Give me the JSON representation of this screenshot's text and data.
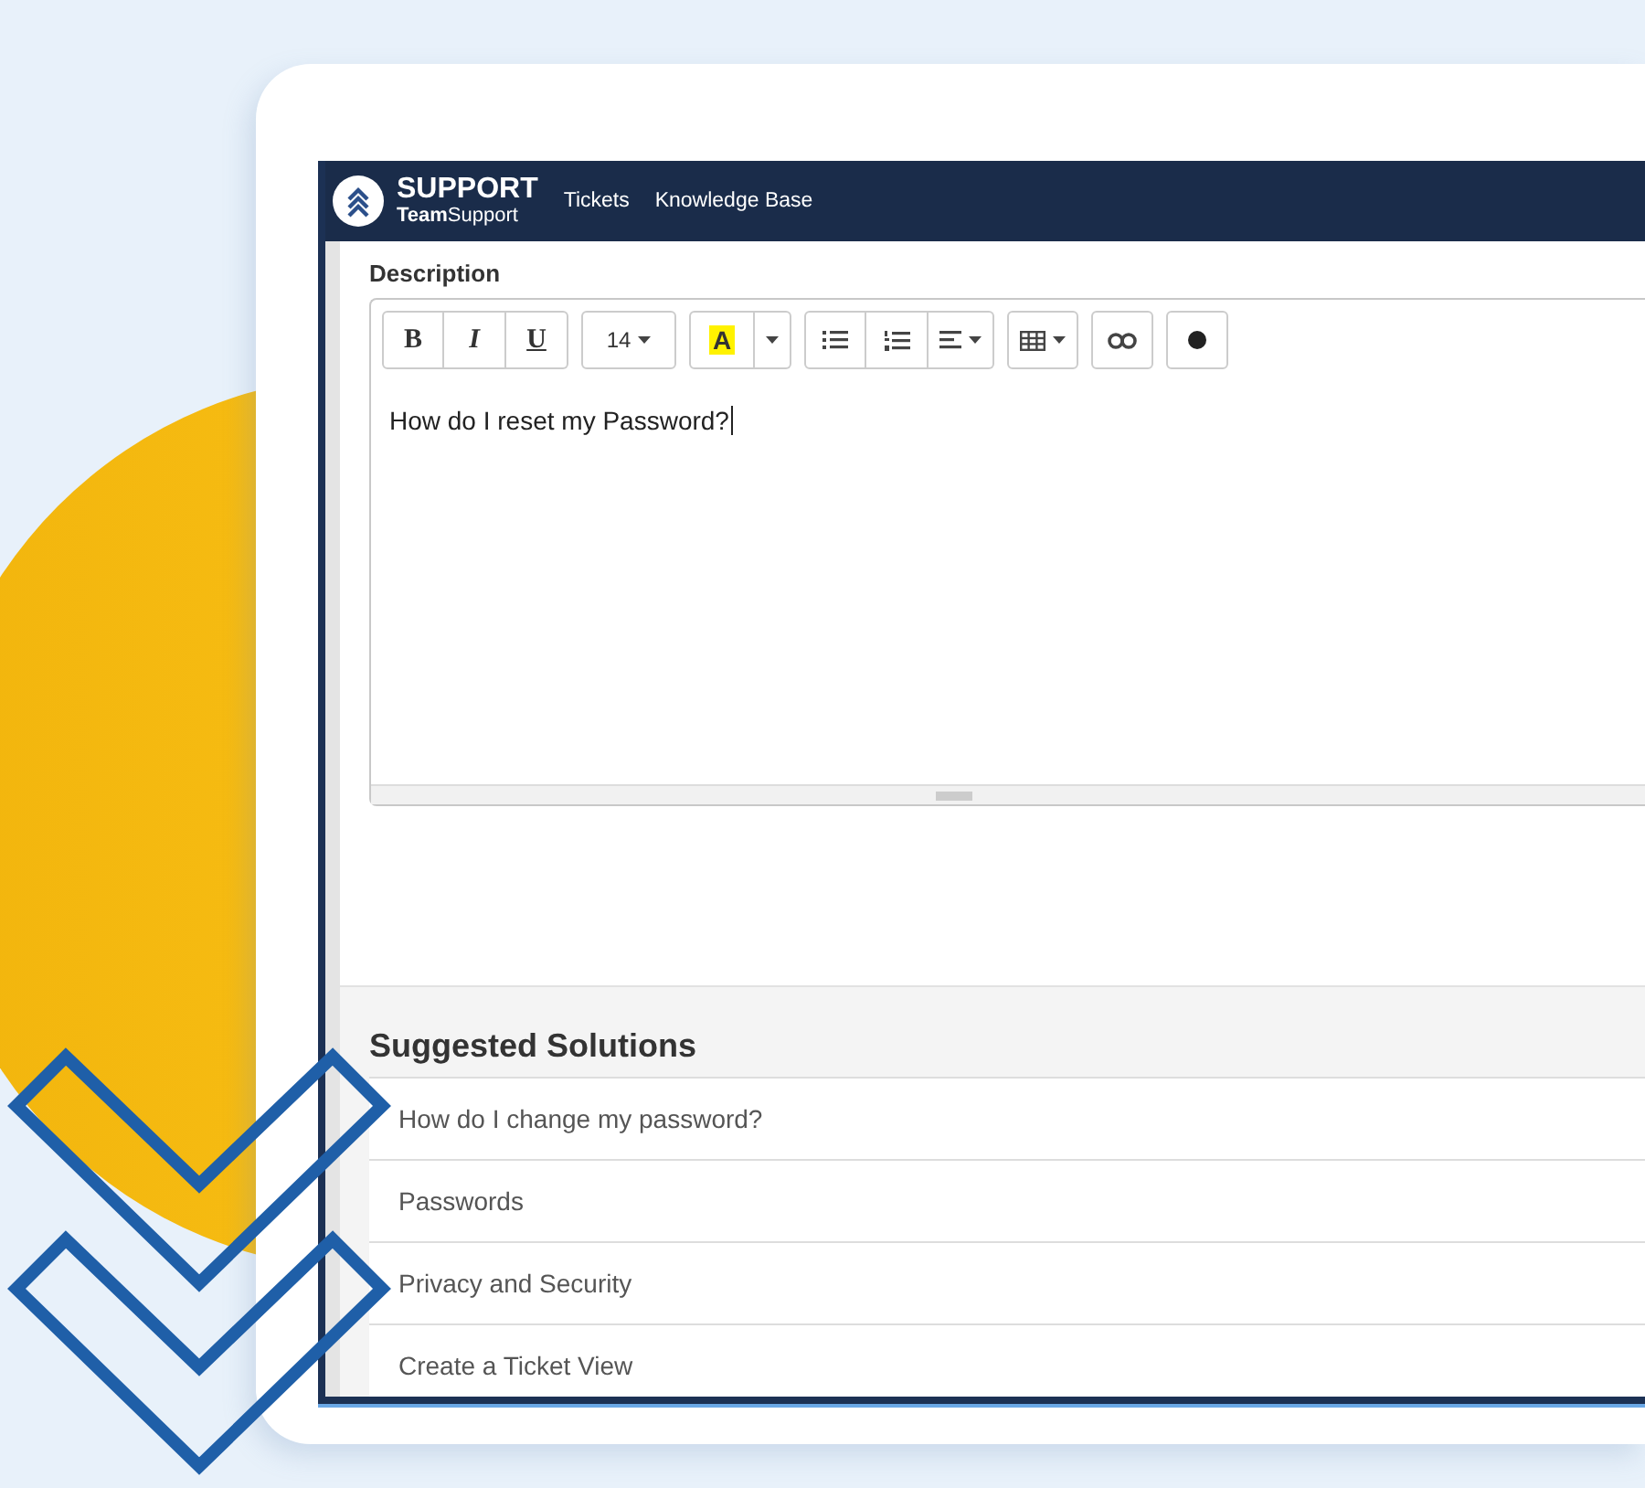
{
  "navbar": {
    "logo_title": "SUPPORT",
    "logo_subtitle": "**Team**Support",
    "links": [
      "Tickets",
      "Knowledge Base"
    ]
  },
  "description": {
    "label": "Description",
    "toolbar": [
      [
        {
          "kind": "bold",
          "label": "B"
        },
        {
          "kind": "italic",
          "label": "I"
        },
        {
          "kind": "underline",
          "label": "U"
        }
      ],
      [
        {
          "kind": "font-size",
          "label": "14"
        }
      ],
      [
        {
          "kind": "text-color",
          "label": "A"
        },
        {
          "kind": "color-menu"
        }
      ],
      [
        {
          "kind": "bullet-list"
        },
        {
          "kind": "numbered-list"
        },
        {
          "kind": "align"
        }
      ],
      [
        {
          "kind": "table"
        }
      ],
      [
        {
          "kind": "link"
        }
      ],
      [
        {
          "kind": "record"
        }
      ]
    ],
    "text": "How do I reset my Password?"
  },
  "suggested_solutions": {
    "title": "Suggested Solutions",
    "items": [
      "How do I change my password?",
      "Passwords",
      "Privacy and Security",
      "Create a Ticket View"
    ]
  }
}
